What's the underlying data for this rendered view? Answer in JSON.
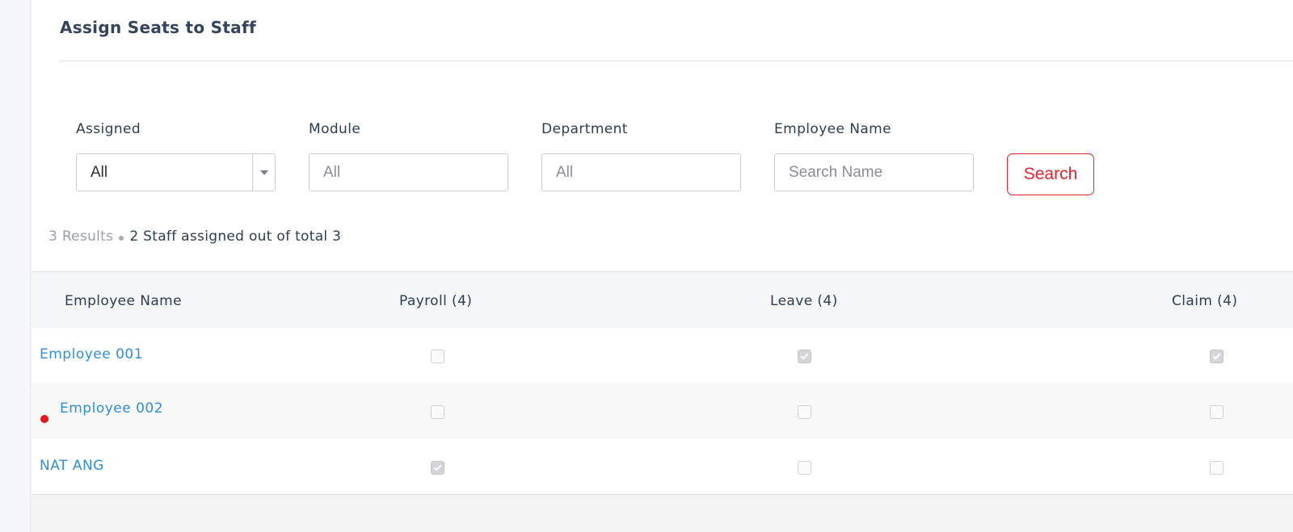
{
  "page": {
    "title": "Assign Seats to Staff"
  },
  "filters": {
    "assigned": {
      "label": "Assigned",
      "value": "All"
    },
    "module": {
      "label": "Module",
      "value": "All"
    },
    "department": {
      "label": "Department",
      "value": "All"
    },
    "employee_name": {
      "label": "Employee Name",
      "placeholder": "Search Name"
    },
    "search_label": "Search"
  },
  "summary": {
    "results": "3 Results",
    "assigned_text": "2 Staff assigned out of total 3"
  },
  "table": {
    "columns": [
      "Employee Name",
      "Payroll (4)",
      "Leave (4)",
      "Claim (4)"
    ],
    "rows": [
      {
        "name": "Employee 001",
        "payroll": false,
        "leave": true,
        "claim": true,
        "flagged": false
      },
      {
        "name": "Employee 002",
        "payroll": false,
        "leave": false,
        "claim": false,
        "flagged": true
      },
      {
        "name": "NAT ANG",
        "payroll": true,
        "leave": false,
        "claim": false,
        "flagged": false
      }
    ]
  },
  "colors": {
    "accent_red": "#e8202a",
    "link_blue": "#2f8fde",
    "flag_red": "#e8141c"
  }
}
